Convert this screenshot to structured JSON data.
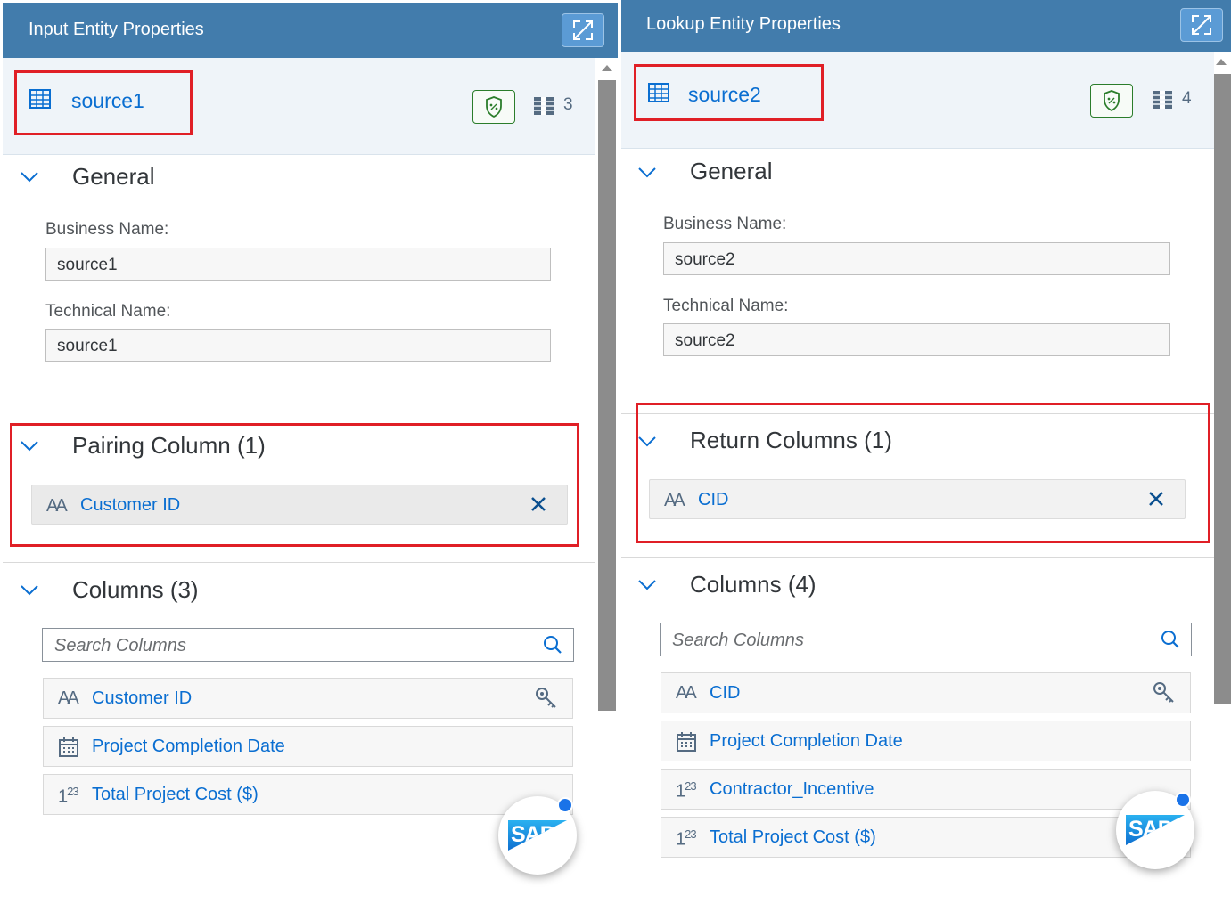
{
  "left": {
    "header_title": "Input Entity Properties",
    "entity_name": "source1",
    "column_count": "3",
    "general": {
      "title": "General",
      "business_name_label": "Business Name:",
      "business_name_value": "source1",
      "technical_name_label": "Technical Name:",
      "technical_name_value": "source1"
    },
    "pairing": {
      "title": "Pairing Column (1)",
      "token": "Customer ID"
    },
    "columns": {
      "title": "Columns (3)",
      "search_placeholder": "Search Columns",
      "items": [
        {
          "label": "Customer ID",
          "type": "text",
          "key": true
        },
        {
          "label": "Project Completion Date",
          "type": "date",
          "key": false
        },
        {
          "label": "Total Project Cost ($)",
          "type": "number",
          "key": false
        }
      ]
    }
  },
  "right": {
    "header_title": "Lookup Entity Properties",
    "entity_name": "source2",
    "column_count": "4",
    "general": {
      "title": "General",
      "business_name_label": "Business Name:",
      "business_name_value": "source2",
      "technical_name_label": "Technical Name:",
      "technical_name_value": "source2"
    },
    "return": {
      "title": "Return Columns (1)",
      "token": "CID"
    },
    "columns": {
      "title": "Columns (4)",
      "search_placeholder": "Search Columns",
      "items": [
        {
          "label": "CID",
          "type": "text",
          "key": true
        },
        {
          "label": "Project Completion Date",
          "type": "date",
          "key": false
        },
        {
          "label": "Contractor_Incentive",
          "type": "number",
          "key": false
        },
        {
          "label": "Total Project Cost ($)",
          "type": "number",
          "key": false
        }
      ]
    }
  },
  "icons": {
    "text_type": "AA",
    "number_type_main": "1",
    "number_type_sup": "23",
    "sap_logo": "SAP"
  },
  "colors": {
    "header_bg": "#427cac",
    "accent": "#0a6ed1",
    "highlight": "#e01f26"
  }
}
